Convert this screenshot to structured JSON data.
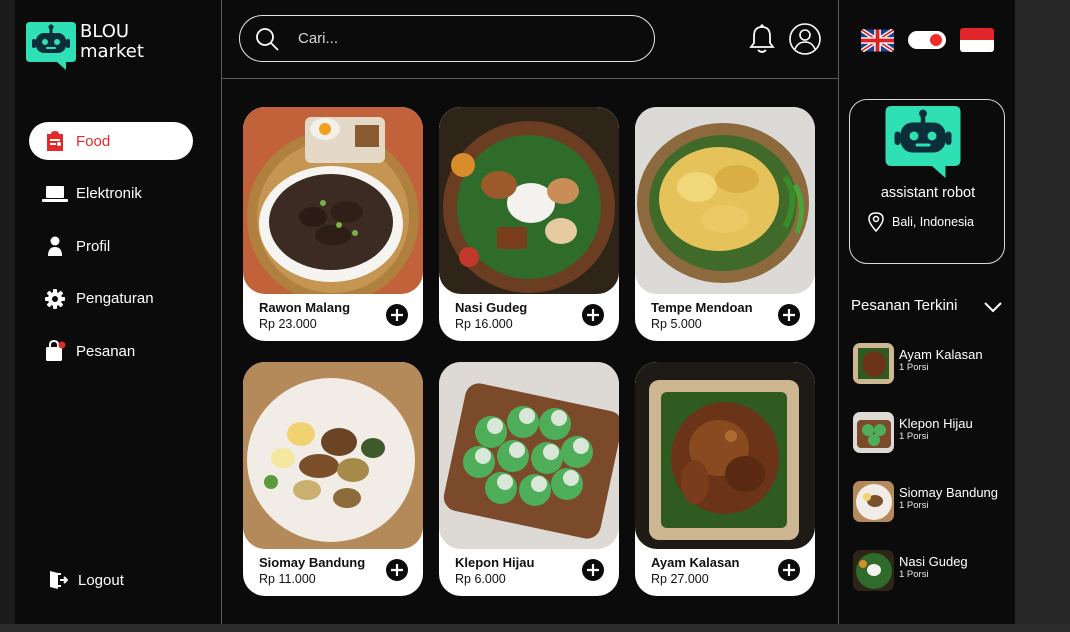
{
  "brand": {
    "name_line1": "BLOU",
    "name_line2": "market",
    "accent": "#2fe0b4"
  },
  "sidebar": {
    "items": [
      {
        "label": "Food",
        "icon": "food-icon",
        "active": true
      },
      {
        "label": "Elektronik",
        "icon": "laptop-icon",
        "active": false
      },
      {
        "label": "Profil",
        "icon": "person-icon",
        "active": false
      },
      {
        "label": "Pengaturan",
        "icon": "gear-icon",
        "active": false
      },
      {
        "label": "Pesanan",
        "icon": "shopping-bag-icon",
        "active": false
      }
    ],
    "logout_label": "Logout"
  },
  "search": {
    "placeholder": "Cari..."
  },
  "products": [
    {
      "name": "Rawon Malang",
      "price": "Rp 23.000"
    },
    {
      "name": "Nasi Gudeg",
      "price": "Rp 16.000"
    },
    {
      "name": "Tempe Mendoan",
      "price": "Rp 5.000"
    },
    {
      "name": "Siomay Bandung",
      "price": "Rp 11.000"
    },
    {
      "name": "Klepon Hijau",
      "price": "Rp 6.000"
    },
    {
      "name": "Ayam Kalasan",
      "price": "Rp 27.000"
    }
  ],
  "assistant": {
    "name": "assistant robot",
    "location": "Bali, Indonesia"
  },
  "recent": {
    "title": "Pesanan Terkini",
    "orders": [
      {
        "name": "Ayam Kalasan",
        "qty": "1 Porsi"
      },
      {
        "name": "Klepon Hijau",
        "qty": "1 Porsi"
      },
      {
        "name": "Siomay Bandung",
        "qty": "1 Porsi"
      },
      {
        "name": "Nasi Gudeg",
        "qty": "1 Porsi"
      }
    ]
  },
  "colors": {
    "active_text": "#e02b2b",
    "toggle_knob": "#ef2b2b",
    "background": "#0b0b0b"
  }
}
